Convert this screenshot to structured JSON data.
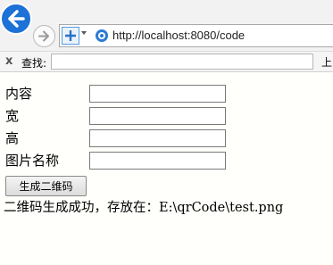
{
  "browser": {
    "url": "http://localhost:8080/code",
    "icons": {
      "back": "back-arrow-icon",
      "forward": "forward-arrow-icon",
      "security": "shield-icon",
      "page": "page-icon"
    }
  },
  "findbar": {
    "close_label": "x",
    "label": "查找:",
    "value": "",
    "prev_label": "上"
  },
  "form": {
    "fields": [
      {
        "label": "内容",
        "value": ""
      },
      {
        "label": "宽",
        "value": ""
      },
      {
        "label": "高",
        "value": ""
      },
      {
        "label": "图片名称",
        "value": ""
      }
    ],
    "submit_label": "生成二维码"
  },
  "result_message": "二维码生成成功，存放在：E:\\qrCode\\test.png",
  "colors": {
    "back_button": "#1c72d6",
    "page_background": "#fffffb"
  }
}
